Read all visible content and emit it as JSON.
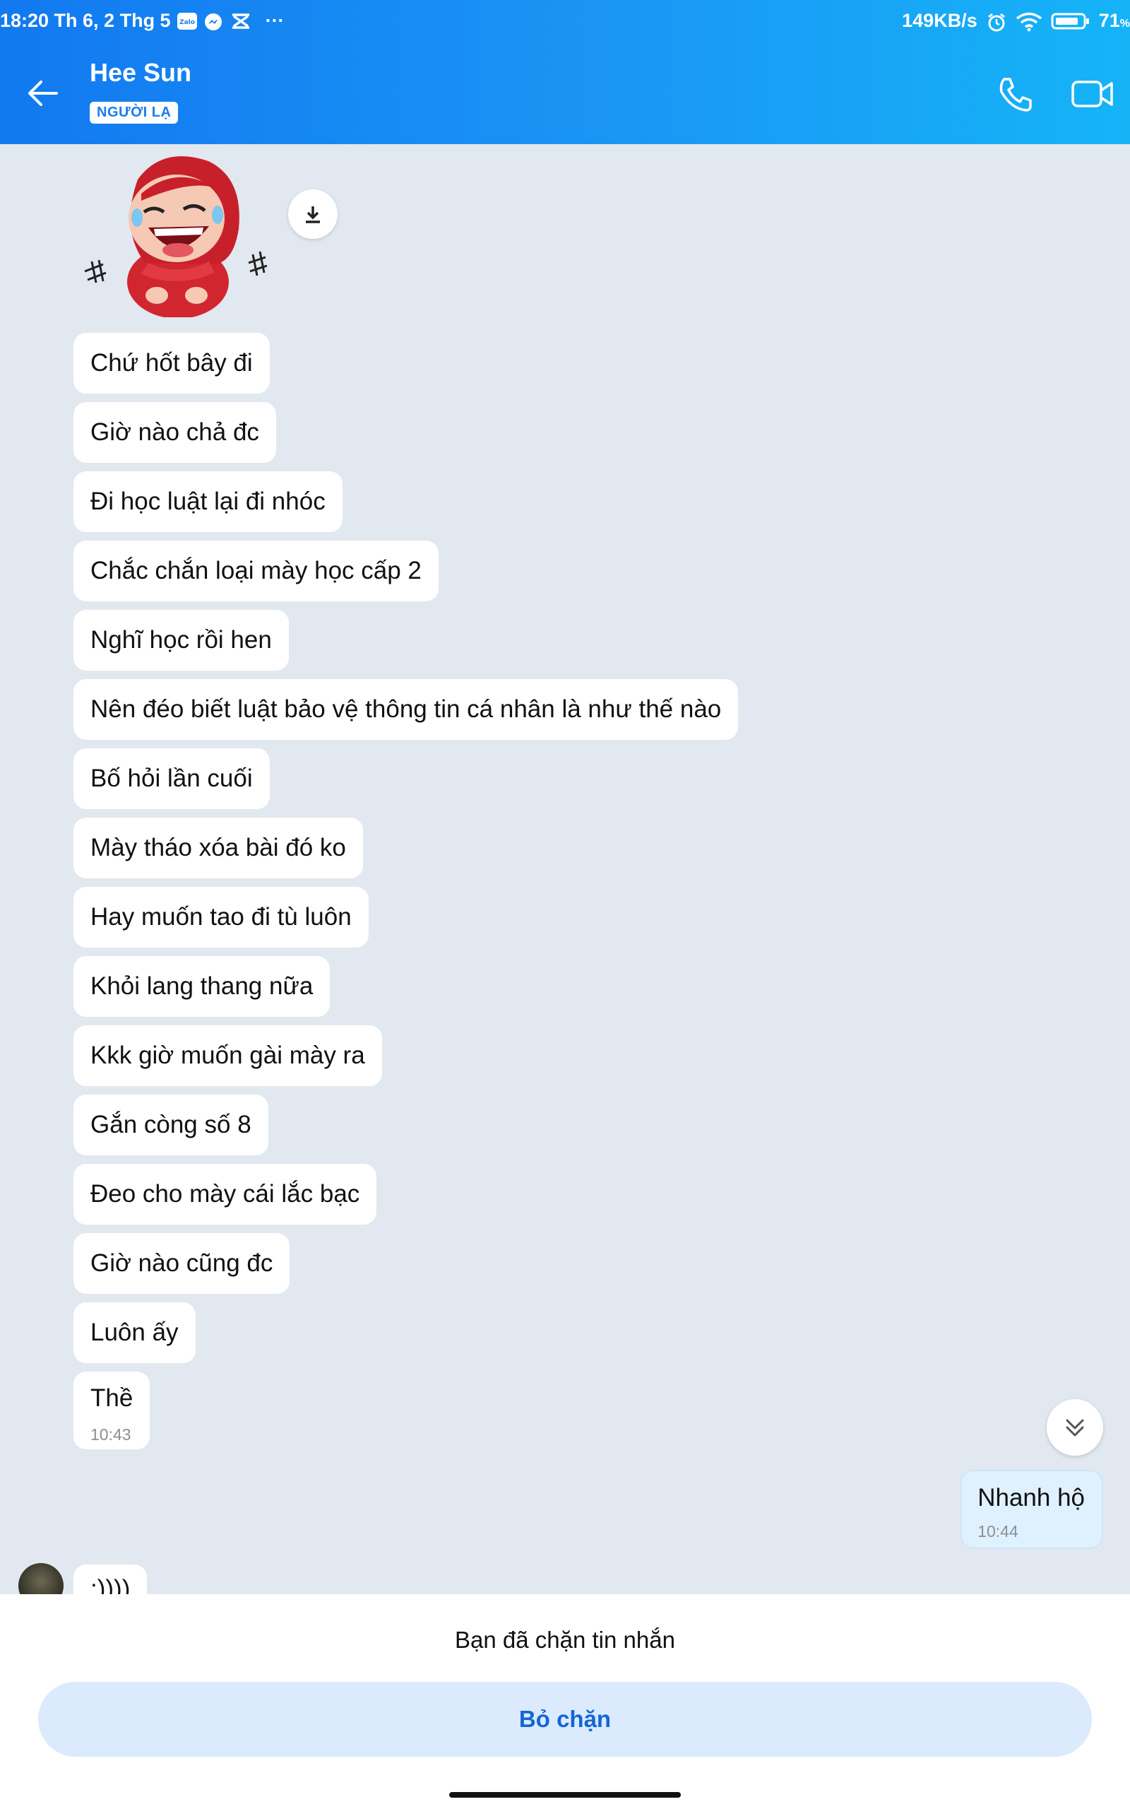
{
  "status_bar": {
    "time_date": "18:20 Th 6, 2 Thg 5",
    "zalo_icon_label": "Zalo",
    "overflow": "···",
    "network_speed": "149KB/s",
    "battery_percent": "71"
  },
  "header": {
    "contact_name": "Hee Sun",
    "badge": "NGƯỜI LẠ"
  },
  "messages_in": [
    "Chứ hốt bây đi",
    "Giờ nào chả đc",
    "Đi học luật lại đi nhóc",
    "Chắc chắn loại mày học cấp 2",
    "Nghĩ học rồi hen",
    "Nên đéo biết luật bảo vệ thông tin cá nhân là như thế nào",
    "Bố hỏi lần cuối",
    "Mày tháo xóa bài đó ko",
    "Hay muốn tao đi tù luôn",
    "Khỏi lang thang nữa",
    "Kkk giờ muốn gài mày ra",
    "Gắn còng số 8",
    "Đeo cho mày cái lắc bạc",
    "Giờ nào cũng đc",
    "Luôn ấy"
  ],
  "last_in": {
    "text": "Thề",
    "time": "10:43"
  },
  "message_out": {
    "text": "Nhanh hộ",
    "time": "10:44"
  },
  "partial_message": ":))))",
  "footer": {
    "blocked_notice": "Bạn đã chặn tin nhắn",
    "unblock_label": "Bỏ chặn"
  },
  "colors": {
    "header_gradient_start": "#1279f0",
    "header_gradient_end": "#15b4f7",
    "chat_background": "#e2e8f0",
    "outgoing_bubble": "#dff1fe",
    "unblock_button_bg": "#dbeafd",
    "unblock_button_text": "#1466d6"
  }
}
